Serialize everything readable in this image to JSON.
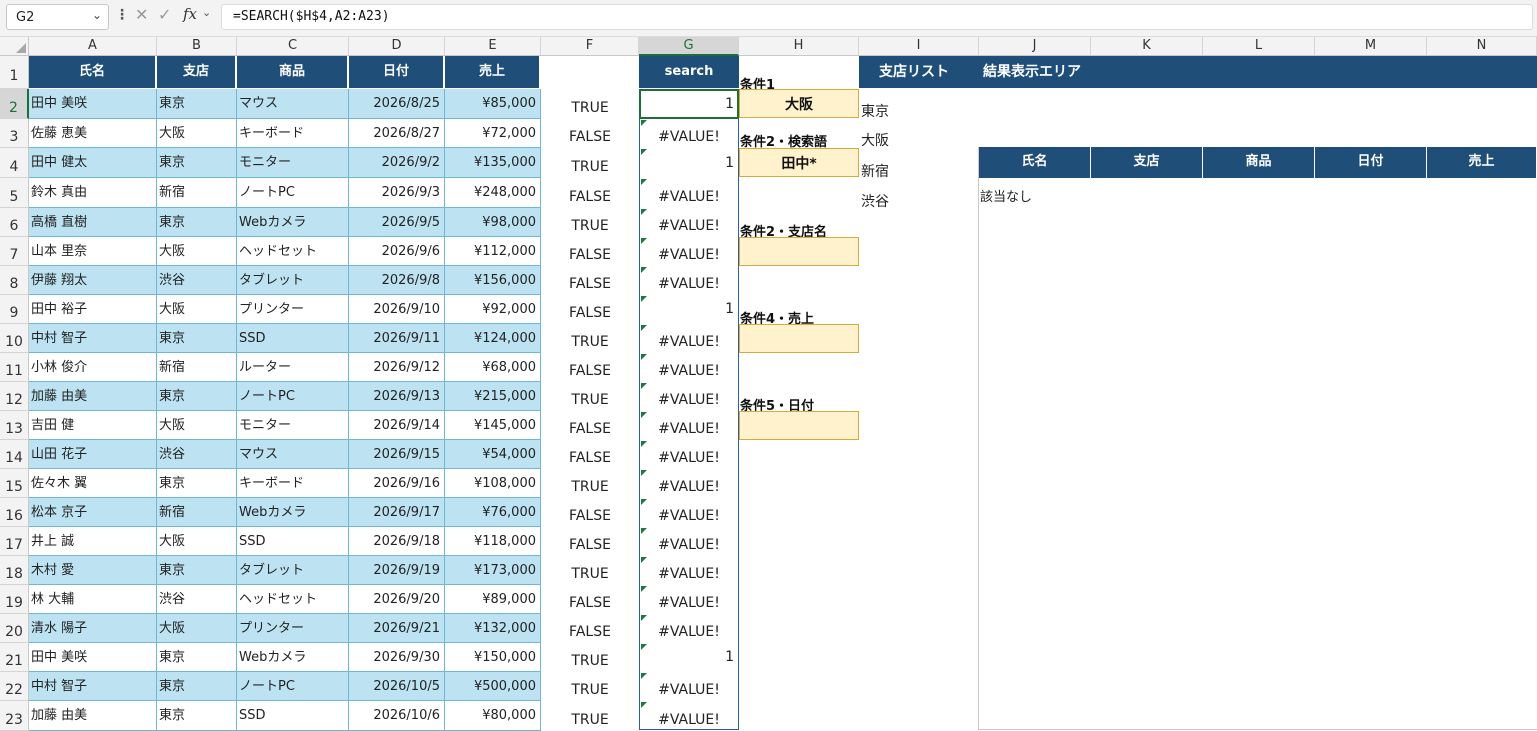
{
  "namebox": "G2",
  "formula": "=SEARCH($H$4,A2:A23)",
  "fx": "fx",
  "columns": [
    "A",
    "B",
    "C",
    "D",
    "E",
    "F",
    "G",
    "H",
    "I",
    "J",
    "K",
    "L",
    "M",
    "N"
  ],
  "rows": [
    "1",
    "2",
    "3",
    "4",
    "5",
    "6",
    "7",
    "8",
    "9",
    "10",
    "11",
    "12",
    "13",
    "14",
    "15",
    "16",
    "17",
    "18",
    "19",
    "20",
    "21",
    "22",
    "23"
  ],
  "headers": {
    "name": "氏名",
    "branch": "支店",
    "product": "商品",
    "date": "日付",
    "sales": "売上",
    "search": "search",
    "branch_list": "支店リスト",
    "result_area": "結果表示エリア"
  },
  "table": [
    {
      "name": "田中 美咲",
      "branch": "東京",
      "product": "マウス",
      "date": "2026/8/25",
      "sales": "¥85,000",
      "f": "TRUE",
      "g": "1"
    },
    {
      "name": "佐藤 恵美",
      "branch": "大阪",
      "product": "キーボード",
      "date": "2026/8/27",
      "sales": "¥72,000",
      "f": "FALSE",
      "g": "#VALUE!"
    },
    {
      "name": "田中 健太",
      "branch": "東京",
      "product": "モニター",
      "date": "2026/9/2",
      "sales": "¥135,000",
      "f": "TRUE",
      "g": "1"
    },
    {
      "name": "鈴木 真由",
      "branch": "新宿",
      "product": "ノートPC",
      "date": "2026/9/3",
      "sales": "¥248,000",
      "f": "FALSE",
      "g": "#VALUE!"
    },
    {
      "name": "高橋 直樹",
      "branch": "東京",
      "product": "Webカメラ",
      "date": "2026/9/5",
      "sales": "¥98,000",
      "f": "TRUE",
      "g": "#VALUE!"
    },
    {
      "name": "山本 里奈",
      "branch": "大阪",
      "product": "ヘッドセット",
      "date": "2026/9/6",
      "sales": "¥112,000",
      "f": "FALSE",
      "g": "#VALUE!"
    },
    {
      "name": "伊藤 翔太",
      "branch": "渋谷",
      "product": "タブレット",
      "date": "2026/9/8",
      "sales": "¥156,000",
      "f": "FALSE",
      "g": "#VALUE!"
    },
    {
      "name": "田中 裕子",
      "branch": "大阪",
      "product": "プリンター",
      "date": "2026/9/10",
      "sales": "¥92,000",
      "f": "FALSE",
      "g": "1"
    },
    {
      "name": "中村 智子",
      "branch": "東京",
      "product": "SSD",
      "date": "2026/9/11",
      "sales": "¥124,000",
      "f": "TRUE",
      "g": "#VALUE!"
    },
    {
      "name": "小林 俊介",
      "branch": "新宿",
      "product": "ルーター",
      "date": "2026/9/12",
      "sales": "¥68,000",
      "f": "FALSE",
      "g": "#VALUE!"
    },
    {
      "name": "加藤 由美",
      "branch": "東京",
      "product": "ノートPC",
      "date": "2026/9/13",
      "sales": "¥215,000",
      "f": "TRUE",
      "g": "#VALUE!"
    },
    {
      "name": "吉田 健",
      "branch": "大阪",
      "product": "モニター",
      "date": "2026/9/14",
      "sales": "¥145,000",
      "f": "FALSE",
      "g": "#VALUE!"
    },
    {
      "name": "山田 花子",
      "branch": "渋谷",
      "product": "マウス",
      "date": "2026/9/15",
      "sales": "¥54,000",
      "f": "FALSE",
      "g": "#VALUE!"
    },
    {
      "name": "佐々木 翼",
      "branch": "東京",
      "product": "キーボード",
      "date": "2026/9/16",
      "sales": "¥108,000",
      "f": "TRUE",
      "g": "#VALUE!"
    },
    {
      "name": "松本 京子",
      "branch": "新宿",
      "product": "Webカメラ",
      "date": "2026/9/17",
      "sales": "¥76,000",
      "f": "FALSE",
      "g": "#VALUE!"
    },
    {
      "name": "井上 誠",
      "branch": "大阪",
      "product": "SSD",
      "date": "2026/9/18",
      "sales": "¥118,000",
      "f": "FALSE",
      "g": "#VALUE!"
    },
    {
      "name": "木村 愛",
      "branch": "東京",
      "product": "タブレット",
      "date": "2026/9/19",
      "sales": "¥173,000",
      "f": "TRUE",
      "g": "#VALUE!"
    },
    {
      "name": "林 大輔",
      "branch": "渋谷",
      "product": "ヘッドセット",
      "date": "2026/9/20",
      "sales": "¥89,000",
      "f": "FALSE",
      "g": "#VALUE!"
    },
    {
      "name": "清水 陽子",
      "branch": "大阪",
      "product": "プリンター",
      "date": "2026/9/21",
      "sales": "¥132,000",
      "f": "FALSE",
      "g": "#VALUE!"
    },
    {
      "name": "田中 美咲",
      "branch": "東京",
      "product": "Webカメラ",
      "date": "2026/9/30",
      "sales": "¥150,000",
      "f": "TRUE",
      "g": "1"
    },
    {
      "name": "中村 智子",
      "branch": "東京",
      "product": "ノートPC",
      "date": "2026/10/5",
      "sales": "¥500,000",
      "f": "TRUE",
      "g": "#VALUE!"
    },
    {
      "name": "加藤 由美",
      "branch": "東京",
      "product": "SSD",
      "date": "2026/10/6",
      "sales": "¥80,000",
      "f": "TRUE",
      "g": "#VALUE!"
    }
  ],
  "conditions": {
    "c1_label": "条件1",
    "c1_value": "大阪",
    "c2_label": "条件2・検索語",
    "c2_value": "田中*",
    "c3_label": "条件2・支店名",
    "c3_value": "",
    "c4_label": "条件4・売上",
    "c4_value": "",
    "c5_label": "条件5・日付",
    "c5_value": ""
  },
  "branch_list": [
    "東京",
    "大阪",
    "新宿",
    "渋谷"
  ],
  "result": {
    "headers": [
      "氏名",
      "支店",
      "商品",
      "日付",
      "売上"
    ],
    "empty_text": "該当なし"
  },
  "colors": {
    "header_blue": "#1f4e79",
    "band_blue": "#bde3f2",
    "condition_fill": "#fff2cc",
    "selection_green": "#1e6e3c"
  }
}
